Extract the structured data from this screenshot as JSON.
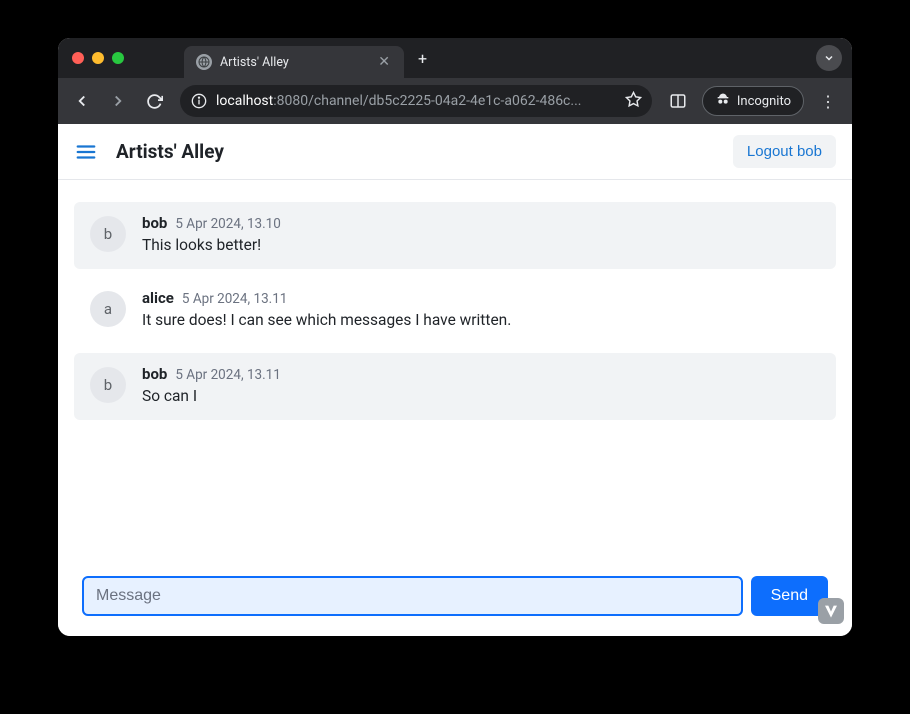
{
  "browser": {
    "tab_title": "Artists' Alley",
    "url_host": "localhost",
    "url_port": ":8080",
    "url_path": "/channel/db5c2225-04a2-4e1c-a062-486c...",
    "incognito_label": "Incognito"
  },
  "header": {
    "title": "Artists' Alley",
    "logout_label": "Logout bob"
  },
  "messages": [
    {
      "author": "bob",
      "avatar": "b",
      "timestamp": "5 Apr 2024, 13.10",
      "text": "This looks better!",
      "own": true
    },
    {
      "author": "alice",
      "avatar": "a",
      "timestamp": "5 Apr 2024, 13.11",
      "text": "It sure does! I can see which messages I have written.",
      "own": false
    },
    {
      "author": "bob",
      "avatar": "b",
      "timestamp": "5 Apr 2024, 13.11",
      "text": "So can I",
      "own": true
    }
  ],
  "composer": {
    "placeholder": "Message",
    "send_label": "Send"
  }
}
